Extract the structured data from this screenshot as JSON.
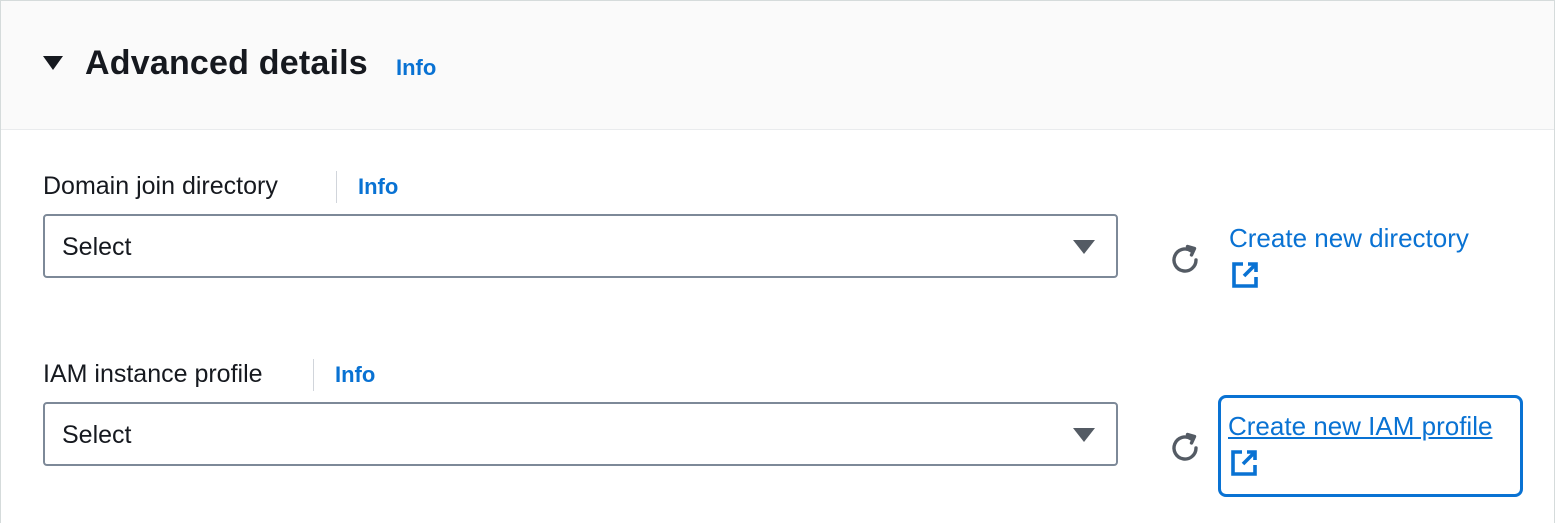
{
  "section": {
    "title": "Advanced details",
    "info_label": "Info",
    "icon": "caret-down-icon"
  },
  "fields": [
    {
      "label": "Domain join directory",
      "info_label": "Info",
      "select_value": "Select",
      "refresh_icon": "refresh-icon",
      "create_link": "Create new directory",
      "external_icon": "external-link-icon"
    },
    {
      "label": "IAM instance profile",
      "info_label": "Info",
      "select_value": "Select",
      "refresh_icon": "refresh-icon",
      "create_link": "Create new IAM profile",
      "external_icon": "external-link-icon",
      "focused": true
    }
  ],
  "colors": {
    "link": "#0972d3",
    "text": "#16191f",
    "header_bg": "#fafafa",
    "select_border": "#7d8998"
  }
}
